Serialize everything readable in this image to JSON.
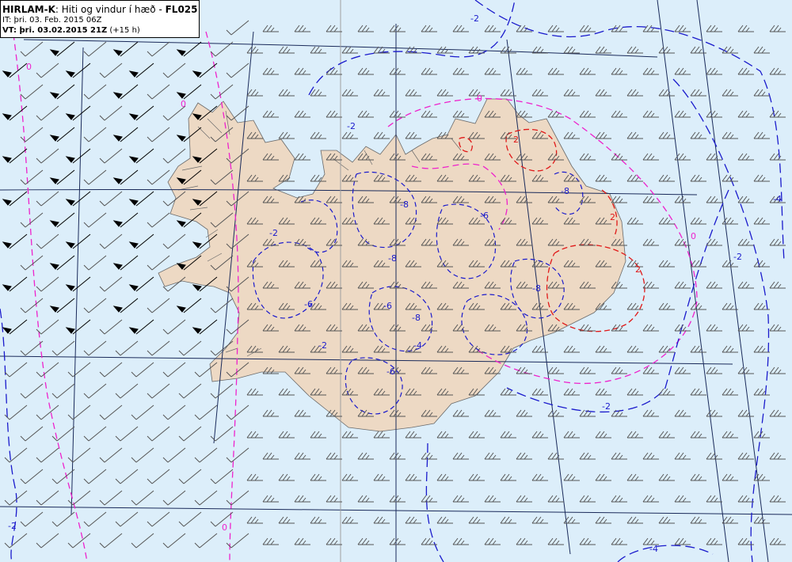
{
  "header": {
    "model": "HIRLAM-K",
    "description": ": Hiti og vindur í hæð - ",
    "level": "FL025",
    "init_time": "IT: þri. 03. Feb. 2015 06Z",
    "valid_label": "VT: þri. 03.02.2015 21Z",
    "lead_time": " (+15 h)"
  },
  "colors": {
    "sea": "#dceefa",
    "land": "#edd9c4",
    "coast": "#6a6a6a",
    "grid": "#1a2a5a",
    "isotherm_negative": "#1a1acc",
    "isotherm_zero": "#ee22cc",
    "isotherm_positive": "#e01818",
    "barb_strong": "#000000",
    "barb_normal": "#555555"
  },
  "isotherm_labels": [
    {
      "text": "0",
      "kind": "zero"
    },
    {
      "text": "0",
      "kind": "zero"
    },
    {
      "text": "0",
      "kind": "zero"
    },
    {
      "text": "0",
      "kind": "zero"
    },
    {
      "text": "0",
      "kind": "zero"
    },
    {
      "text": "-2",
      "kind": "neg"
    },
    {
      "text": "-2",
      "kind": "neg"
    },
    {
      "text": "-2",
      "kind": "neg"
    },
    {
      "text": "-2",
      "kind": "neg"
    },
    {
      "text": "-2",
      "kind": "neg"
    },
    {
      "text": "-2",
      "kind": "neg"
    },
    {
      "text": "-2",
      "kind": "neg"
    },
    {
      "text": "-4",
      "kind": "neg"
    },
    {
      "text": "-4",
      "kind": "neg"
    },
    {
      "text": "-4",
      "kind": "neg"
    },
    {
      "text": "-6",
      "kind": "neg"
    },
    {
      "text": "-6",
      "kind": "neg"
    },
    {
      "text": "-6",
      "kind": "neg"
    },
    {
      "text": "-6",
      "kind": "neg"
    },
    {
      "text": "-8",
      "kind": "neg"
    },
    {
      "text": "-8",
      "kind": "neg"
    },
    {
      "text": "-8",
      "kind": "neg"
    },
    {
      "text": "-8",
      "kind": "neg"
    },
    {
      "text": "-8",
      "kind": "neg"
    },
    {
      "text": "2",
      "kind": "pos"
    },
    {
      "text": "2",
      "kind": "pos"
    },
    {
      "text": "2",
      "kind": "pos"
    }
  ]
}
